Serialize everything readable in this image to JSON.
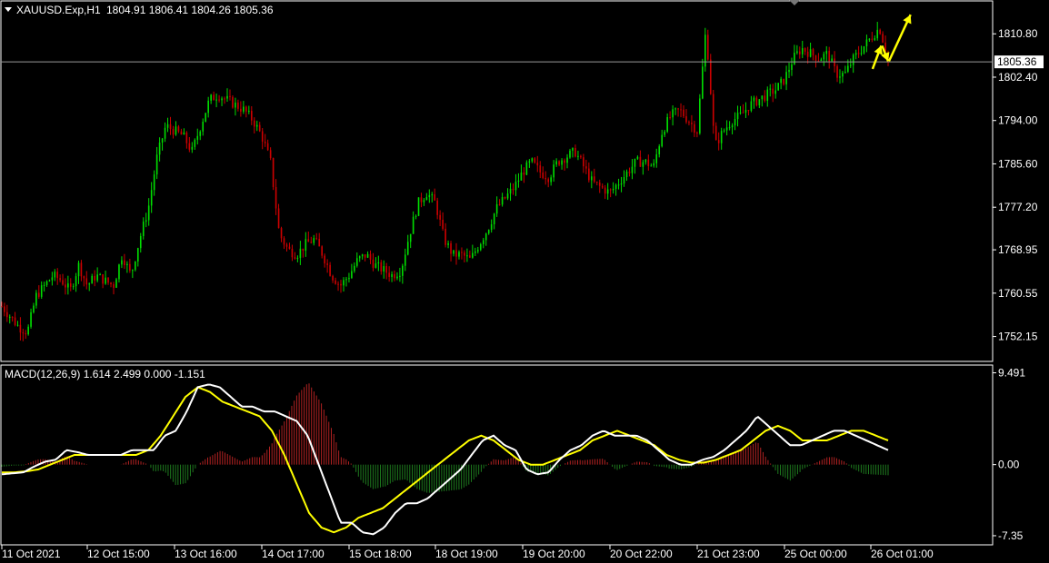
{
  "header": {
    "symbol": "XAUUSD.Exp,H1",
    "ohlc": "1804.91 1806.41 1804.26 1805.36"
  },
  "macd_header": {
    "label": "MACD(12,26,9) 1.614 2.499 0.000 -1.151"
  },
  "colors": {
    "background": "#000000",
    "bull": "#00dd00",
    "bear": "#cc0000",
    "grid": "#ffffff",
    "signal": "#ffff00",
    "macd_line": "#ffffff",
    "hist_pos": "#b22222",
    "hist_neg": "#1e7a1e",
    "arrow": "#ffff00"
  },
  "chart_data": [
    {
      "type": "candlestick",
      "title": "XAUUSD.Exp,H1",
      "current_price": "1805.36",
      "ylim": [
        1747.5,
        1817.0
      ],
      "y_ticks": [
        "1810.80",
        "1802.40",
        "1794.00",
        "1785.60",
        "1777.20",
        "1768.95",
        "1760.55",
        "1752.15"
      ],
      "x_ticks": [
        "11 Oct 2021",
        "12 Oct 15:00",
        "13 Oct 16:00",
        "14 Oct 17:00",
        "15 Oct 18:00",
        "18 Oct 19:00",
        "19 Oct 20:00",
        "20 Oct 22:00",
        "21 Oct 23:00",
        "25 Oct 00:00",
        "26 Oct 01:00"
      ],
      "anchor_x": [
        0,
        10,
        20,
        30,
        40,
        50,
        60,
        70,
        80,
        90,
        100
      ],
      "price_path": {
        "x": [
          0,
          1,
          2,
          3,
          4,
          5,
          6,
          7,
          8,
          9,
          10,
          11,
          12,
          13,
          14,
          15,
          16,
          17,
          18,
          19,
          20,
          21,
          22,
          23,
          24,
          25,
          26,
          27,
          28,
          29,
          30,
          31,
          32,
          33,
          34,
          35,
          36,
          37,
          38,
          39,
          40,
          41,
          42,
          43,
          44,
          45,
          46,
          47,
          48,
          49,
          50,
          51,
          52,
          53,
          54,
          55,
          56,
          57,
          58,
          59,
          60,
          61,
          62,
          63,
          64,
          65,
          66,
          67,
          68,
          69,
          70,
          71,
          72,
          73,
          74,
          75,
          76,
          77,
          78,
          79,
          80,
          81,
          82,
          83,
          84,
          85,
          86,
          87,
          88,
          89,
          90,
          91,
          92,
          93,
          94,
          95,
          96,
          97,
          98,
          99,
          100,
          101,
          102
        ],
        "y": [
          1758,
          1756,
          1754,
          1753,
          1760,
          1762,
          1764,
          1763,
          1761,
          1766,
          1762,
          1764,
          1763,
          1762,
          1768,
          1764,
          1771,
          1777,
          1787,
          1793,
          1792,
          1791,
          1788,
          1793,
          1798,
          1799,
          1798,
          1797,
          1796,
          1794,
          1791,
          1786,
          1772,
          1769,
          1768,
          1770,
          1771,
          1768,
          1764,
          1762,
          1764,
          1767,
          1768,
          1766,
          1765,
          1764,
          1765,
          1772,
          1778,
          1780,
          1778,
          1771,
          1768,
          1768,
          1767,
          1770,
          1773,
          1777,
          1779,
          1781,
          1784,
          1786,
          1784,
          1783,
          1786,
          1787,
          1788,
          1785,
          1782,
          1781,
          1780,
          1782,
          1784,
          1786,
          1786,
          1785,
          1792,
          1795,
          1796,
          1794,
          1792,
          1812,
          1789,
          1792,
          1794,
          1795,
          1797,
          1798,
          1799,
          1800,
          1802,
          1806,
          1808,
          1807,
          1806,
          1807,
          1803,
          1803,
          1806,
          1808,
          1810,
          1812,
          1806
        ]
      }
    },
    {
      "type": "line",
      "title": "MACD(12,26,9) 1.614 2.499 0.000 -1.151",
      "ylim": [
        -8.2,
        10.2
      ],
      "y_ticks": [
        "9.491",
        "0.00",
        "-7.35"
      ],
      "series": [
        {
          "name": "",
          "role": "macd",
          "values": [
            -1.0,
            -0.9,
            -0.8,
            -0.2,
            0.3,
            0.5,
            1.5,
            1.3,
            1.0,
            1.0,
            1.0,
            1.0,
            1.5,
            1.5,
            1.5,
            3.0,
            3.5,
            5.5,
            8.0,
            8.3,
            8.0,
            7.0,
            6.0,
            6.0,
            5.5,
            5.5,
            5.0,
            4.5,
            3.0,
            0.0,
            -3.0,
            -6.0,
            -6.0,
            -7.0,
            -7.2,
            -6.5,
            -5.0,
            -4.0,
            -4.0,
            -3.5,
            -2.5,
            -1.5,
            -0.5,
            1.0,
            2.5,
            3.0,
            2.0,
            1.5,
            -0.5,
            -1.0,
            -0.8,
            0.5,
            1.5,
            2.0,
            3.0,
            3.5,
            3.0,
            3.0,
            3.0,
            2.5,
            1.5,
            0.5,
            0.0,
            0.0,
            0.5,
            0.8,
            1.5,
            2.5,
            3.5,
            5.0,
            4.0,
            3.0,
            2.0,
            2.0,
            2.5,
            3.0,
            3.5,
            3.5,
            3.0,
            2.5,
            2.0,
            1.5
          ]
        },
        {
          "name": "",
          "role": "signal",
          "values": [
            -0.8,
            -0.8,
            -0.7,
            -0.5,
            0.0,
            0.5,
            1.0,
            1.0,
            1.0,
            1.0,
            1.0,
            1.0,
            1.5,
            3.0,
            5.0,
            7.0,
            8.0,
            7.5,
            6.5,
            6.0,
            5.5,
            5.0,
            3.5,
            1.0,
            -2.0,
            -5.0,
            -6.5,
            -7.0,
            -6.5,
            -5.5,
            -5.0,
            -4.5,
            -3.5,
            -2.5,
            -1.5,
            -0.5,
            0.5,
            1.5,
            2.5,
            3.0,
            2.5,
            1.5,
            0.5,
            0.0,
            0.0,
            0.5,
            1.0,
            1.5,
            2.5,
            3.0,
            3.5,
            3.0,
            2.5,
            2.0,
            1.0,
            0.5,
            0.2,
            0.2,
            0.5,
            1.0,
            1.5,
            2.5,
            3.5,
            4.0,
            3.5,
            2.5,
            2.5,
            2.5,
            3.0,
            3.5,
            3.5,
            3.0,
            2.5
          ]
        }
      ],
      "histogram": {
        "name": ""
      }
    }
  ],
  "arrows": [
    "yellow-arrow-up",
    "yellow-arrow-down",
    "yellow-arrow-up"
  ]
}
